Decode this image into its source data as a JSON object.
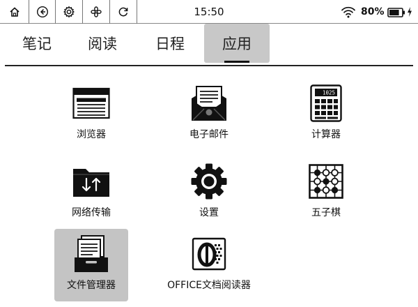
{
  "status_bar": {
    "buttons": [
      {
        "icon": "home-icon"
      },
      {
        "icon": "back-icon"
      },
      {
        "icon": "settings-icon"
      },
      {
        "icon": "apps-grid-icon"
      },
      {
        "icon": "refresh-icon"
      }
    ],
    "time": "15:50",
    "wifi_icon": "wifi-icon",
    "battery_percent": "80%",
    "battery_level": 0.8,
    "charging_icon": "charging-icon"
  },
  "tabs": [
    {
      "label": "笔记",
      "active": false
    },
    {
      "label": "阅读",
      "active": false
    },
    {
      "label": "日程",
      "active": false
    },
    {
      "label": "应用",
      "active": true
    }
  ],
  "apps": [
    {
      "label": "浏览器",
      "icon": "browser-icon",
      "selected": false
    },
    {
      "label": "电子邮件",
      "icon": "email-icon",
      "selected": false
    },
    {
      "label": "计算器",
      "icon": "calculator-icon",
      "selected": false,
      "display_text": "1025"
    },
    {
      "label": "网络传输",
      "icon": "network-transfer-icon",
      "selected": false
    },
    {
      "label": "设置",
      "icon": "settings-gear-icon",
      "selected": false
    },
    {
      "label": "五子棋",
      "icon": "gomoku-icon",
      "selected": false
    },
    {
      "label": "文件管理器",
      "icon": "file-manager-icon",
      "selected": true
    },
    {
      "label": "OFFICE文档阅读器",
      "icon": "office-reader-icon",
      "selected": false
    }
  ]
}
